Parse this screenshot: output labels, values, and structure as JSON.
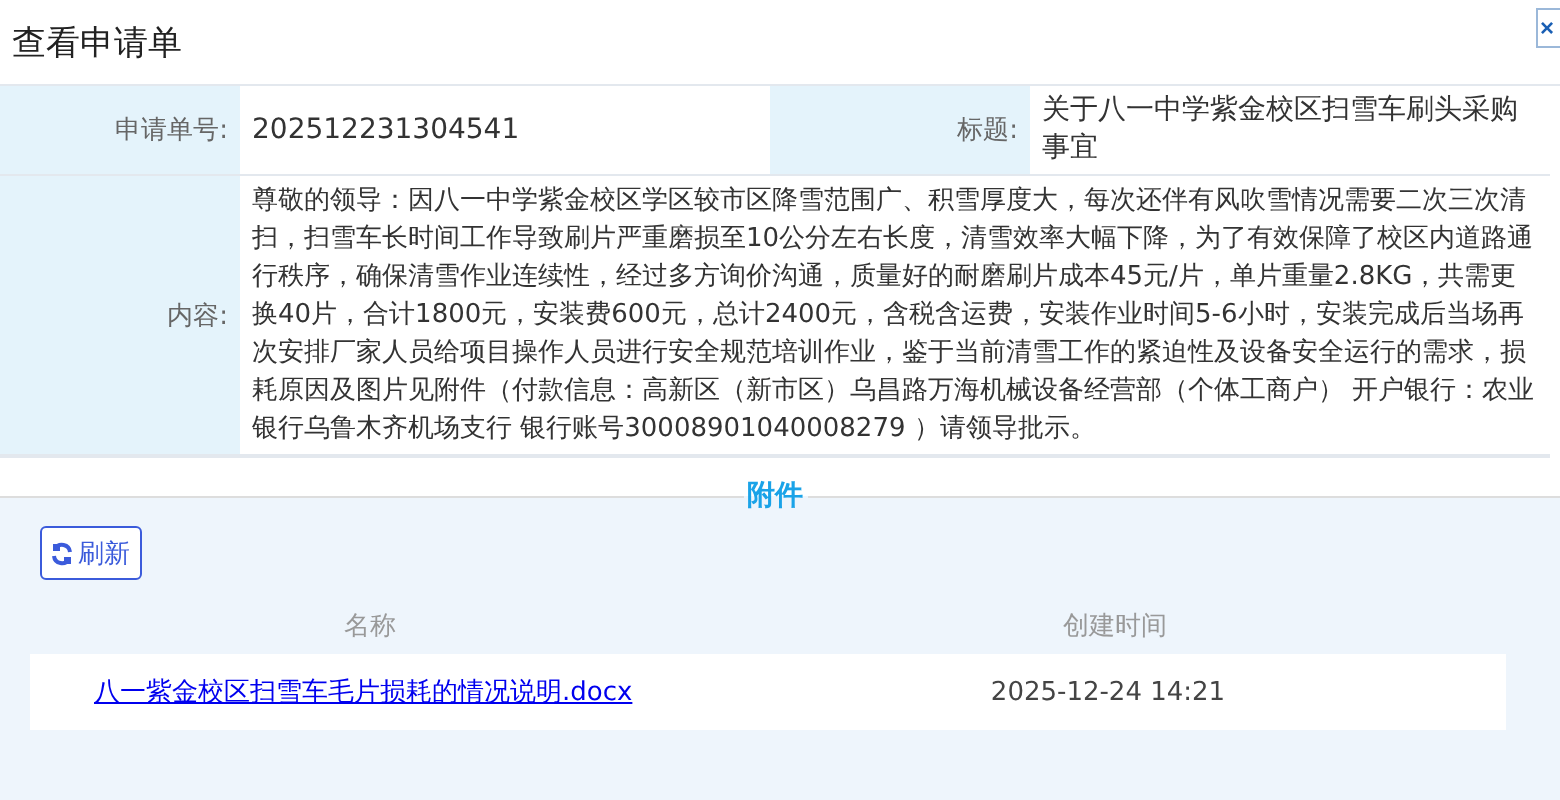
{
  "window": {
    "title": "查看申请单",
    "close": "×"
  },
  "form": {
    "fields": [
      {
        "label": "申请单号:",
        "value": "202512231304541"
      },
      {
        "label": "标题:",
        "value": "关于八一中学紫金校区扫雪车刷头采购事宜"
      }
    ],
    "content": {
      "label": "内容:",
      "value": "尊敬的领导：因八一中学紫金校区学区较市区降雪范围广、积雪厚度大，每次还伴有风吹雪情况需要二次三次清扫，扫雪车长时间工作导致刷片严重磨损至10公分左右长度，清雪效率大幅下降，为了有效保障了校区内道路通行秩序，确保清雪作业连续性，经过多方询价沟通，质量好的耐磨刷片成本45元/片，单片重量2.8KG，共需更换40片，合计1800元，安装费600元，总计2400元，含税含运费，安装作业时间5-6小时，安装完成后当场再次安排厂家人员给项目操作人员进行安全规范培训作业，鉴于当前清雪工作的紧迫性及设备安全运行的需求，损耗原因及图片见附件（付款信息：高新区（新市区）乌昌路万海机械设备经营部（个体工商户） 开户银行：农业银行乌鲁木齐机场支行 银行账号30008901040008279 ）请领导批示。"
    }
  },
  "attachments": {
    "legend": "附件",
    "refresh": "刷新",
    "columns": [
      "名称",
      "创建时间"
    ],
    "rows": [
      {
        "name": "八一紫金校区扫雪车毛片损耗的情况说明.docx",
        "created": "2025-12-24 14:21"
      }
    ]
  }
}
